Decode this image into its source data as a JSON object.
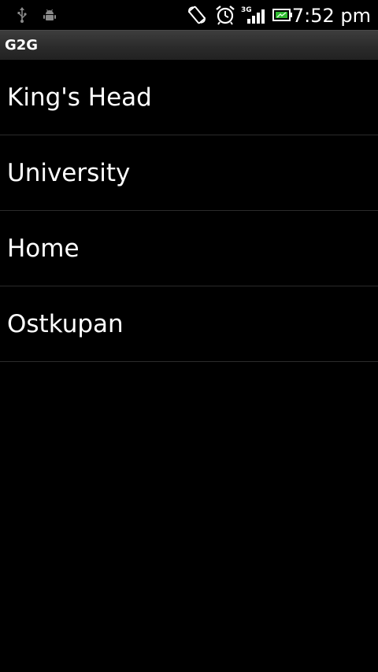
{
  "status_bar": {
    "time": "7:52 pm",
    "network_label": "3G",
    "icons": [
      "usb-icon",
      "android-debug-icon",
      "auto-rotate-icon",
      "alarm-icon",
      "signal-icon",
      "battery-icon"
    ]
  },
  "app": {
    "title": "G2G"
  },
  "list": {
    "items": [
      {
        "label": "King's Head"
      },
      {
        "label": "University"
      },
      {
        "label": "Home"
      },
      {
        "label": "Ostkupan"
      }
    ]
  }
}
